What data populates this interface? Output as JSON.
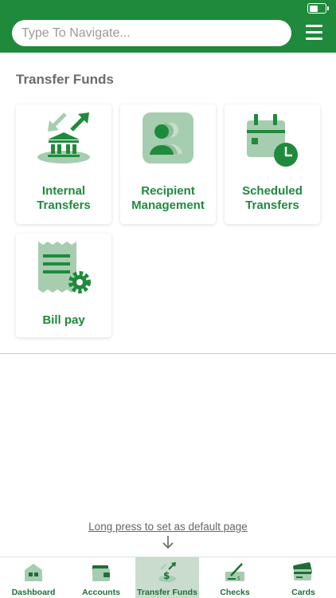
{
  "search": {
    "placeholder": "Type To Navigate..."
  },
  "section": {
    "title": "Transfer Funds"
  },
  "cards": [
    {
      "line1": "Internal",
      "line2": "Transfers"
    },
    {
      "line1": "Recipient",
      "line2": "Management"
    },
    {
      "line1": "Scheduled",
      "line2": "Transfers"
    },
    {
      "line1": "Bill pay"
    }
  ],
  "hint": {
    "text": "Long press to set as default page"
  },
  "tabs": [
    {
      "label": "Dashboard"
    },
    {
      "label": "Accounts"
    },
    {
      "label": "Transfer Funds",
      "active": true
    },
    {
      "label": "Checks"
    },
    {
      "label": "Cards"
    }
  ],
  "colors": {
    "primary": "#1f8a3c",
    "light": "#a6cdb0",
    "active_tab": "#c9dccd"
  },
  "battery": {
    "level": 0.6
  }
}
